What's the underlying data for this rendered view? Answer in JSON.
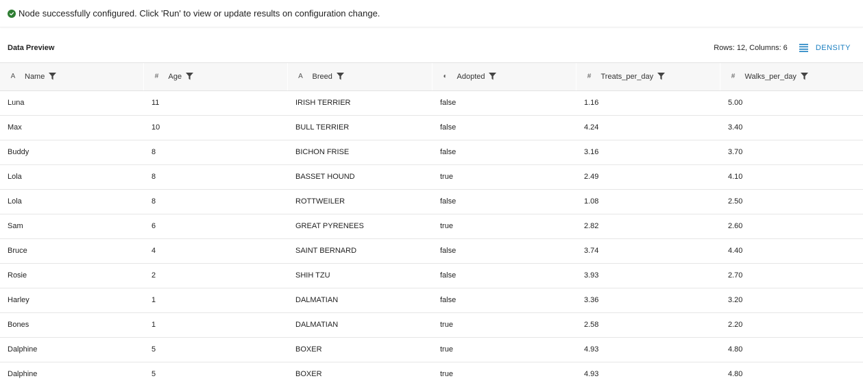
{
  "status": {
    "message": "Node successfully configured. Click 'Run' to view or update results on configuration change.",
    "icon": "check-circle-icon",
    "color": "#2e7d32"
  },
  "preview": {
    "title": "Data Preview",
    "meta": "Rows: 12, Columns: 6",
    "density_label": "DENSITY",
    "accent": "#1a7fc1"
  },
  "columns": [
    {
      "label": "Name",
      "type_glyph": "A"
    },
    {
      "label": "Age",
      "type_glyph": "#"
    },
    {
      "label": "Breed",
      "type_glyph": "A"
    },
    {
      "label": "Adopted",
      "type_glyph": "◐"
    },
    {
      "label": "Treats_per_day",
      "type_glyph": "#"
    },
    {
      "label": "Walks_per_day",
      "type_glyph": "#"
    }
  ],
  "rows": [
    [
      "Luna",
      "11",
      "IRISH TERRIER",
      "false",
      "1.16",
      "5.00"
    ],
    [
      "Max",
      "10",
      "BULL TERRIER",
      "false",
      "4.24",
      "3.40"
    ],
    [
      "Buddy",
      "8",
      "BICHON FRISE",
      "false",
      "3.16",
      "3.70"
    ],
    [
      "Lola",
      "8",
      "BASSET HOUND",
      "true",
      "2.49",
      "4.10"
    ],
    [
      "Lola",
      "8",
      "ROTTWEILER",
      "false",
      "1.08",
      "2.50"
    ],
    [
      "Sam",
      "6",
      "GREAT PYRENEES",
      "true",
      "2.82",
      "2.60"
    ],
    [
      "Bruce",
      "4",
      "SAINT BERNARD",
      "false",
      "3.74",
      "4.40"
    ],
    [
      "Rosie",
      "2",
      "SHIH TZU",
      "false",
      "3.93",
      "2.70"
    ],
    [
      "Harley",
      "1",
      "DALMATIAN",
      "false",
      "3.36",
      "3.20"
    ],
    [
      "Bones",
      "1",
      "DALMATIAN",
      "true",
      "2.58",
      "2.20"
    ],
    [
      "Dalphine",
      "5",
      "BOXER",
      "true",
      "4.93",
      "4.80"
    ],
    [
      "Dalphine",
      "5",
      "BOXER",
      "true",
      "4.93",
      "4.80"
    ]
  ]
}
